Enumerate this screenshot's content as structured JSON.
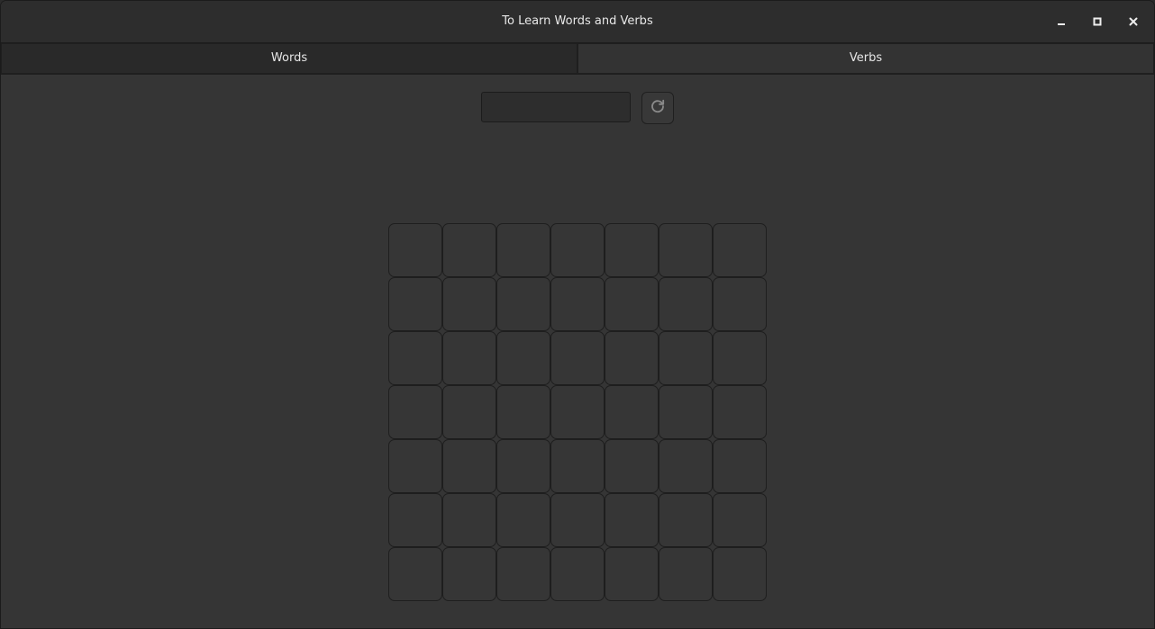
{
  "window": {
    "title": "To Learn Words and Verbs",
    "controls": {
      "minimize_icon": "minimize-icon",
      "maximize_icon": "maximize-icon",
      "close_icon": "close-icon"
    }
  },
  "tabs": [
    {
      "label": "Words",
      "active": true
    },
    {
      "label": "Verbs",
      "active": false
    }
  ],
  "search": {
    "value": "",
    "placeholder": ""
  },
  "refresh": {
    "icon": "refresh-icon"
  },
  "grid": {
    "rows": 7,
    "cols": 7,
    "cells": [
      [
        "",
        "",
        "",
        "",
        "",
        "",
        ""
      ],
      [
        "",
        "",
        "",
        "",
        "",
        "",
        ""
      ],
      [
        "",
        "",
        "",
        "",
        "",
        "",
        ""
      ],
      [
        "",
        "",
        "",
        "",
        "",
        "",
        ""
      ],
      [
        "",
        "",
        "",
        "",
        "",
        "",
        ""
      ],
      [
        "",
        "",
        "",
        "",
        "",
        "",
        ""
      ],
      [
        "",
        "",
        "",
        "",
        "",
        "",
        ""
      ]
    ]
  },
  "colors": {
    "background": "#353535",
    "titlebar": "#2d2d2d",
    "tab_active": "#292929",
    "tab_inactive": "#333333",
    "cell": "#363636",
    "border": "#1e1e1e",
    "text": "#e6e6e6"
  }
}
